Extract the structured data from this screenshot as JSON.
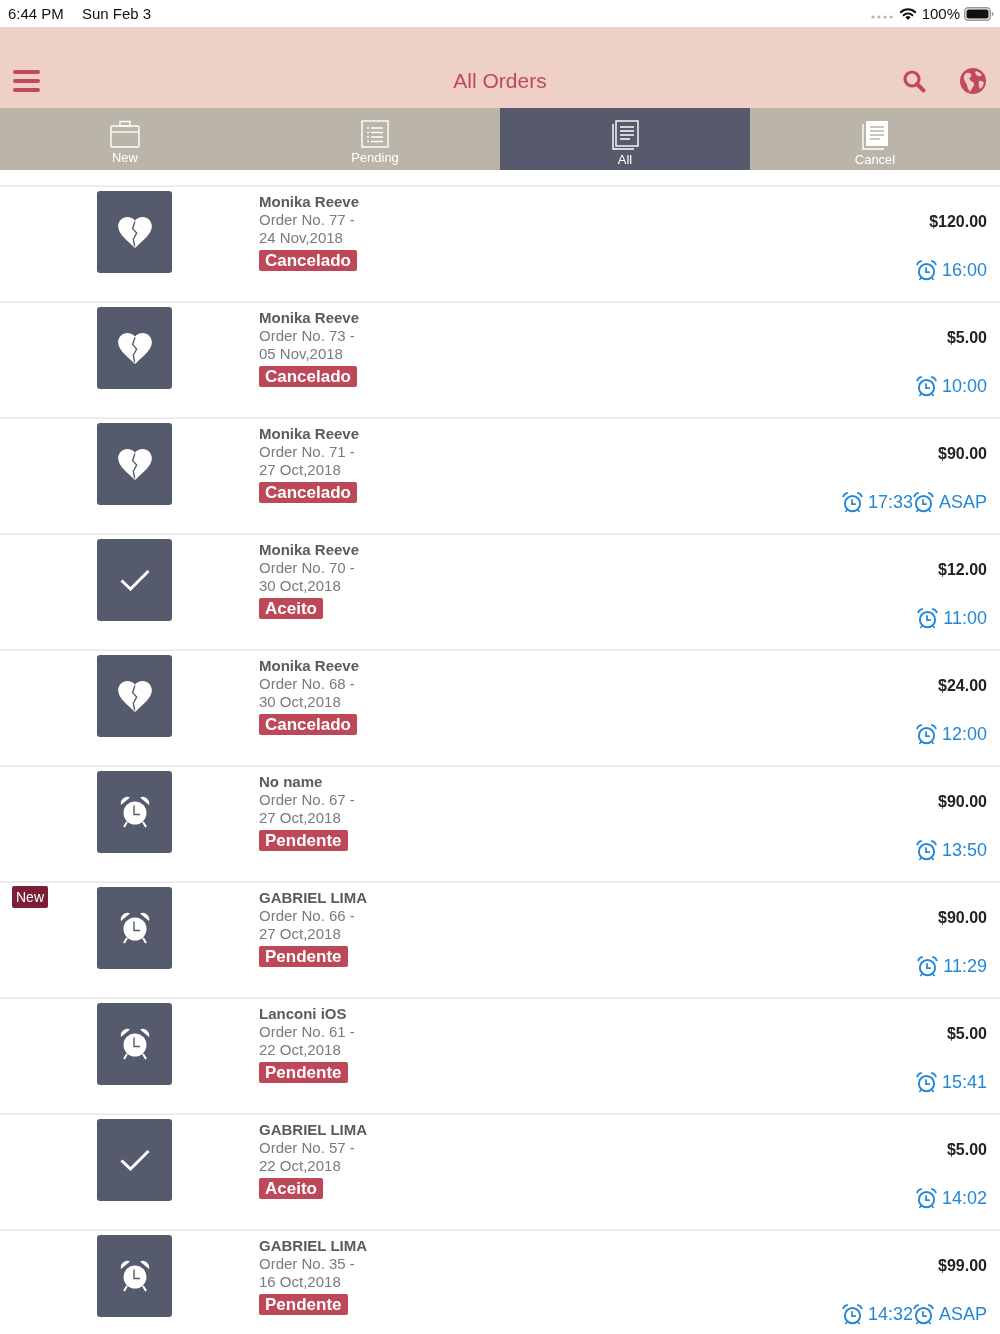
{
  "status_bar": {
    "time": "6:44 PM",
    "date": "Sun Feb 3",
    "battery": "100%"
  },
  "header": {
    "title": "All Orders"
  },
  "tabs": [
    {
      "label": "New",
      "selected": false
    },
    {
      "label": "Pending",
      "selected": false
    },
    {
      "label": "All",
      "selected": true
    },
    {
      "label": "Cancel",
      "selected": false
    }
  ],
  "orders": [
    {
      "kind": "cancelled",
      "name": "Monika Reeve",
      "order_no": "Order No. 77 -",
      "date": "24 Nov,2018",
      "status": "Cancelado",
      "price": "$120.00",
      "times": [
        "16:00"
      ]
    },
    {
      "kind": "cancelled",
      "name": "Monika Reeve",
      "order_no": "Order No. 73 -",
      "date": "05 Nov,2018",
      "status": "Cancelado",
      "price": "$5.00",
      "times": [
        "10:00"
      ]
    },
    {
      "kind": "cancelled",
      "name": "Monika Reeve",
      "order_no": "Order No. 71 -",
      "date": "27 Oct,2018",
      "status": "Cancelado",
      "price": "$90.00",
      "times": [
        "17:33",
        "ASAP"
      ]
    },
    {
      "kind": "accepted",
      "name": "Monika Reeve",
      "order_no": "Order No. 70 -",
      "date": "30 Oct,2018",
      "status": "Aceito",
      "price": "$12.00",
      "times": [
        "11:00"
      ]
    },
    {
      "kind": "cancelled",
      "name": "Monika Reeve",
      "order_no": "Order No. 68 -",
      "date": "30 Oct,2018",
      "status": "Cancelado",
      "price": "$24.00",
      "times": [
        "12:00"
      ]
    },
    {
      "kind": "pending",
      "name": "No name",
      "order_no": "Order No. 67 -",
      "date": "27 Oct,2018",
      "status": "Pendente",
      "price": "$90.00",
      "times": [
        "13:50"
      ]
    },
    {
      "kind": "pending",
      "new_tag": "New",
      "name": "GABRIEL LIMA",
      "order_no": "Order No. 66 -",
      "date": "27 Oct,2018",
      "status": "Pendente",
      "price": "$90.00",
      "times": [
        "11:29"
      ]
    },
    {
      "kind": "pending",
      "name": "Lanconi iOS",
      "order_no": "Order No. 61 -",
      "date": "22 Oct,2018",
      "status": "Pendente",
      "price": "$5.00",
      "times": [
        "15:41"
      ]
    },
    {
      "kind": "accepted",
      "name": "GABRIEL LIMA",
      "order_no": "Order No. 57 -",
      "date": "22 Oct,2018",
      "status": "Aceito",
      "price": "$5.00",
      "times": [
        "14:02"
      ]
    },
    {
      "kind": "pending",
      "name": "GABRIEL LIMA",
      "order_no": "Order No. 35 -",
      "date": "16 Oct,2018",
      "status": "Pendente",
      "price": "$99.00",
      "times": [
        "14:32",
        "ASAP"
      ]
    }
  ]
}
